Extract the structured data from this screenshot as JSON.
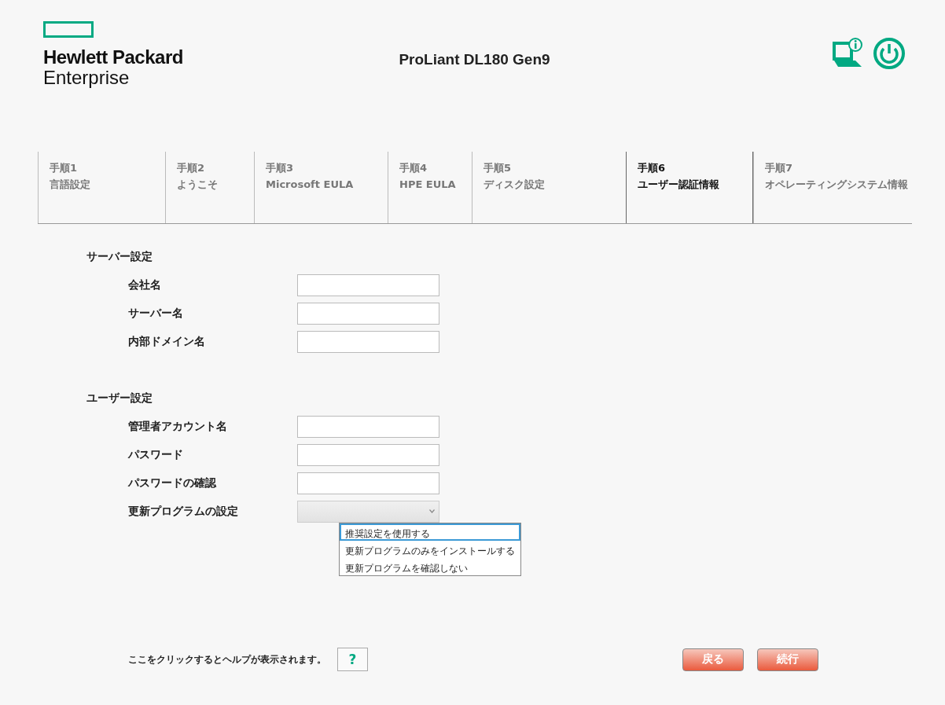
{
  "header": {
    "logo_line1": "Hewlett Packard",
    "logo_line2": "Enterprise",
    "title": "ProLiant DL180 Gen9"
  },
  "steps": [
    {
      "step": "手順1",
      "label": "言語設定",
      "selected": false
    },
    {
      "step": "手順2",
      "label": "ようこそ",
      "selected": false
    },
    {
      "step": "手順3",
      "label": "Microsoft EULA",
      "selected": false
    },
    {
      "step": "手順4",
      "label": "HPE EULA",
      "selected": false
    },
    {
      "step": "手順5",
      "label": "ディスク設定",
      "selected": false
    },
    {
      "step": "手順6",
      "label": "ユーザー認証情報",
      "selected": true
    },
    {
      "step": "手順7",
      "label": "オペレーティングシステム情報",
      "selected": false
    }
  ],
  "sections": [
    {
      "heading": "サーバー設定",
      "fields": [
        {
          "kind": "text",
          "label": "会社名"
        },
        {
          "kind": "text",
          "label": "サーバー名"
        },
        {
          "kind": "text",
          "label": "内部ドメイン名"
        }
      ]
    },
    {
      "heading": "ユーザー設定",
      "fields": [
        {
          "kind": "text",
          "label": "管理者アカウント名"
        },
        {
          "kind": "password",
          "label": "パスワード"
        },
        {
          "kind": "password",
          "label": "パスワードの確認"
        },
        {
          "kind": "dropdown",
          "label": "更新プログラムの設定",
          "expanded": true,
          "options": [
            {
              "label": "推奨設定を使用する",
              "selected": true
            },
            {
              "label": "更新プログラムのみをインストールする",
              "selected": false
            },
            {
              "label": "更新プログラムを確認しない",
              "selected": false
            }
          ]
        }
      ]
    }
  ],
  "footer": {
    "help_text": "ここをクリックするとヘルプが表示されます。",
    "help_button": "?",
    "buttons": [
      "戻る",
      "続行"
    ]
  }
}
